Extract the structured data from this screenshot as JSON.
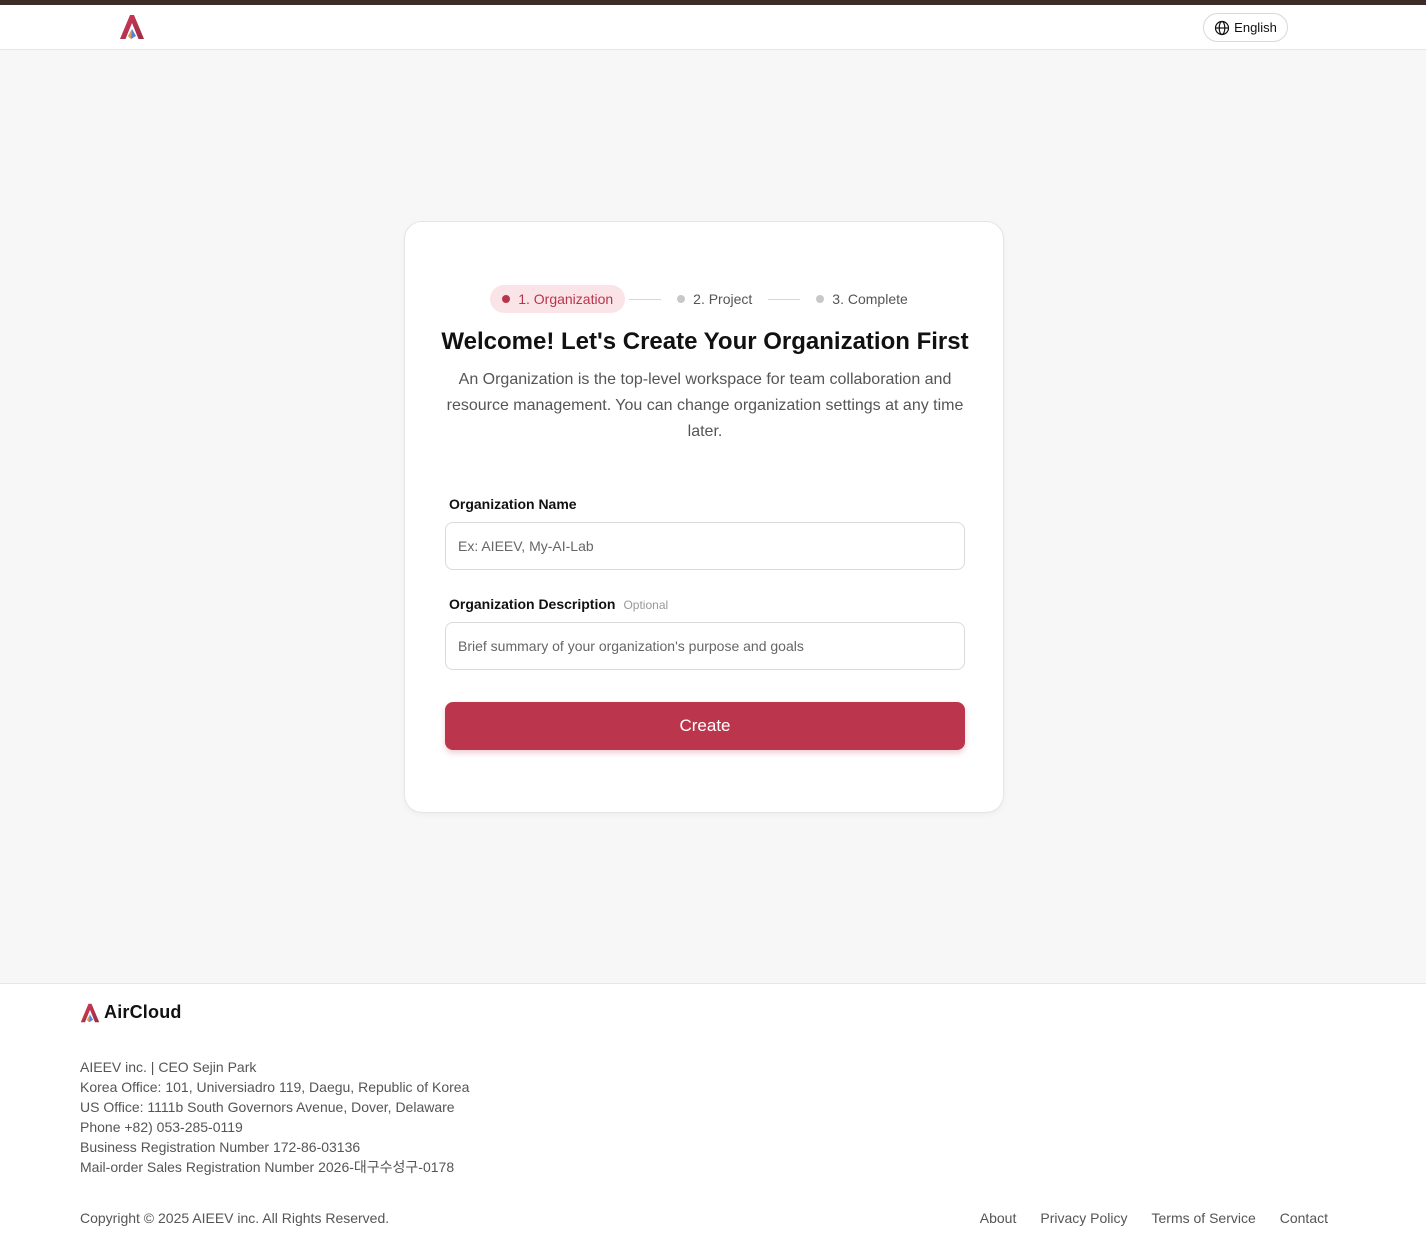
{
  "header": {
    "language_label": "English"
  },
  "stepper": {
    "steps": [
      {
        "label": "1. Organization",
        "active": true
      },
      {
        "label": "2. Project",
        "active": false
      },
      {
        "label": "3. Complete",
        "active": false
      }
    ]
  },
  "form": {
    "title": "Welcome! Let's Create Your Organization First",
    "description": "An Organization is the top-level workspace for team collaboration and resource management. You can change organization settings at any time later.",
    "name_label": "Organization Name",
    "name_value": "",
    "name_placeholder": "Ex: AIEEV, My-AI-Lab",
    "desc_label": "Organization Description",
    "desc_optional": "Optional",
    "desc_value": "",
    "desc_placeholder": "Brief summary of your organization's purpose and goals",
    "submit_label": "Create"
  },
  "footer": {
    "brand": "AirCloud",
    "info_lines": [
      "AIEEV inc. | CEO Sejin Park",
      "Korea Office: 101, Universiadro 119, Daegu, Republic of Korea",
      "US Office: 1111b South Governors Avenue, Dover, Delaware",
      "Phone +82) 053-285-0119",
      "Business Registration Number 172-86-03136",
      "Mail-order Sales Registration Number 2026-대구수성구-0178"
    ],
    "copyright": "Copyright © 2025 AIEEV inc. All Rights Reserved.",
    "links": [
      "About",
      "Privacy Policy",
      "Terms of Service",
      "Contact"
    ]
  },
  "colors": {
    "brand_red": "#bb364c",
    "active_step_bg": "#fbe4e7",
    "top_stripe": "#3d2b28"
  },
  "icons": {
    "logo": "aircloud-logo-icon",
    "language": "globe-icon"
  }
}
